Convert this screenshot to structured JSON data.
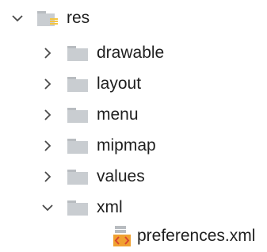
{
  "tree": {
    "root": {
      "label": "res",
      "expanded": true,
      "icon": "resource-folder-icon"
    },
    "children": [
      {
        "label": "drawable",
        "expanded": false,
        "icon": "folder-icon"
      },
      {
        "label": "layout",
        "expanded": false,
        "icon": "folder-icon"
      },
      {
        "label": "menu",
        "expanded": false,
        "icon": "folder-icon"
      },
      {
        "label": "mipmap",
        "expanded": false,
        "icon": "folder-icon"
      },
      {
        "label": "values",
        "expanded": false,
        "icon": "folder-icon"
      },
      {
        "label": "xml",
        "expanded": true,
        "icon": "folder-icon"
      }
    ],
    "file": {
      "label": "preferences.xml",
      "icon": "xml-file-icon"
    }
  },
  "colors": {
    "folder_fill": "#c9cdd1",
    "folder_tab": "#b8bcc0",
    "resource_accent": "#f4c542",
    "chevron": "#4a4a4a",
    "xml_tag_red": "#d9462f",
    "xml_tag_orange": "#f0a030"
  }
}
